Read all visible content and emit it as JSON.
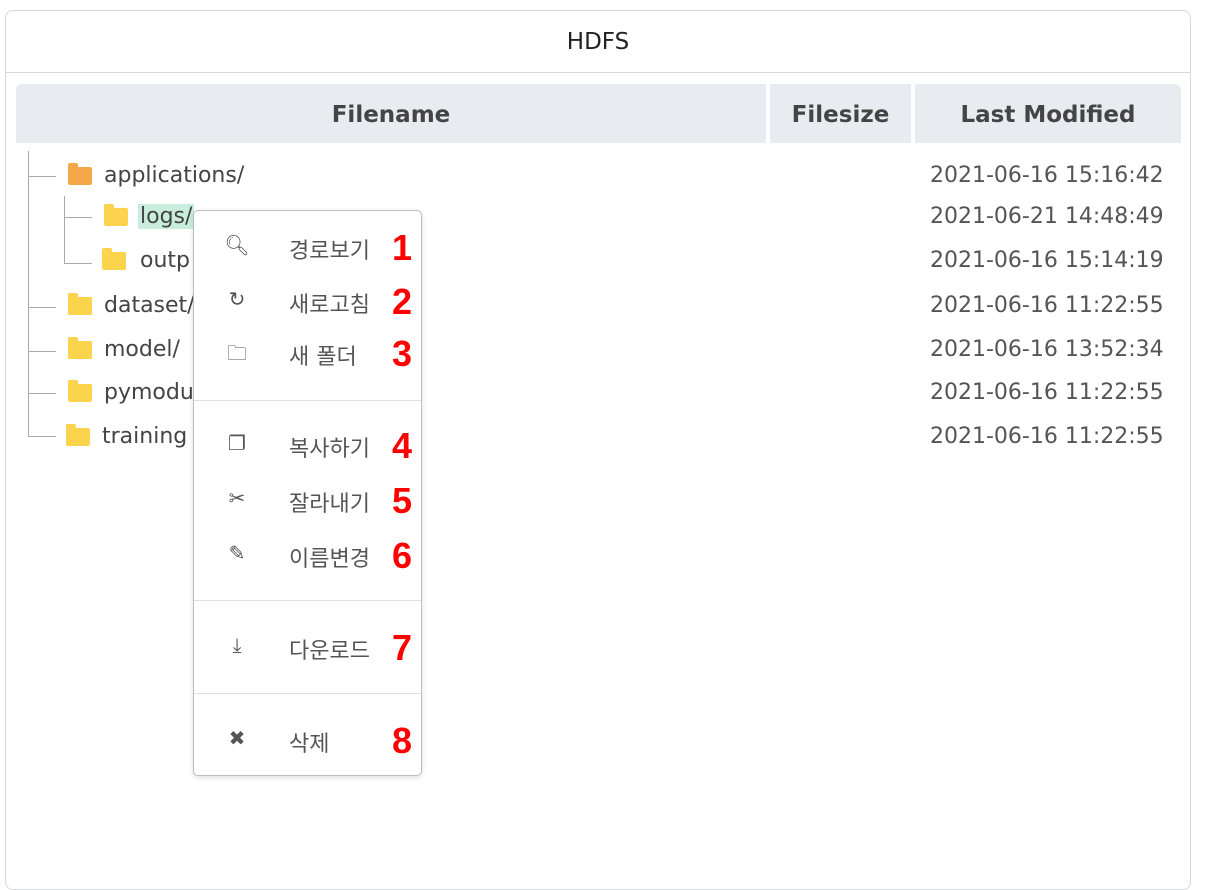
{
  "panel": {
    "title": "HDFS"
  },
  "table": {
    "columns": [
      "Filename",
      "Filesize",
      "Last Modified"
    ]
  },
  "rows": [
    {
      "name": "applications/",
      "modified": "2021-06-16 15:16:42",
      "icon": "folder-open-icon"
    },
    {
      "name": "logs/",
      "modified": "2021-06-21 14:48:49",
      "icon": "folder-icon",
      "selected": true
    },
    {
      "name": "outp",
      "modified": "2021-06-16 15:14:19",
      "icon": "folder-icon"
    },
    {
      "name": "dataset/",
      "modified": "2021-06-16 11:22:55",
      "icon": "folder-icon"
    },
    {
      "name": "model/",
      "modified": "2021-06-16 13:52:34",
      "icon": "folder-icon"
    },
    {
      "name": "pymodu",
      "modified": "2021-06-16 11:22:55",
      "icon": "folder-icon"
    },
    {
      "name": "training",
      "modified": "2021-06-16 11:22:55",
      "icon": "folder-icon"
    }
  ],
  "context_menu": {
    "items": [
      {
        "label": "경로보기",
        "icon": "search-icon",
        "number": "1"
      },
      {
        "label": "새로고침",
        "icon": "refresh-icon",
        "number": "2"
      },
      {
        "label": "새 폴더",
        "icon": "folder-outline-icon",
        "number": "3"
      },
      {
        "label": "복사하기",
        "icon": "copy-icon",
        "number": "4"
      },
      {
        "label": "잘라내기",
        "icon": "scissors-icon",
        "number": "5"
      },
      {
        "label": "이름변경",
        "icon": "edit-icon",
        "number": "6"
      },
      {
        "label": "다운로드",
        "icon": "download-icon",
        "number": "7"
      },
      {
        "label": "삭제",
        "icon": "close-icon",
        "number": "8"
      }
    ]
  },
  "colors": {
    "selected_bg": "#c9eedd",
    "folder": "#fcd34d",
    "folder_open": "#f6a849",
    "annotation": "#ff0000"
  }
}
